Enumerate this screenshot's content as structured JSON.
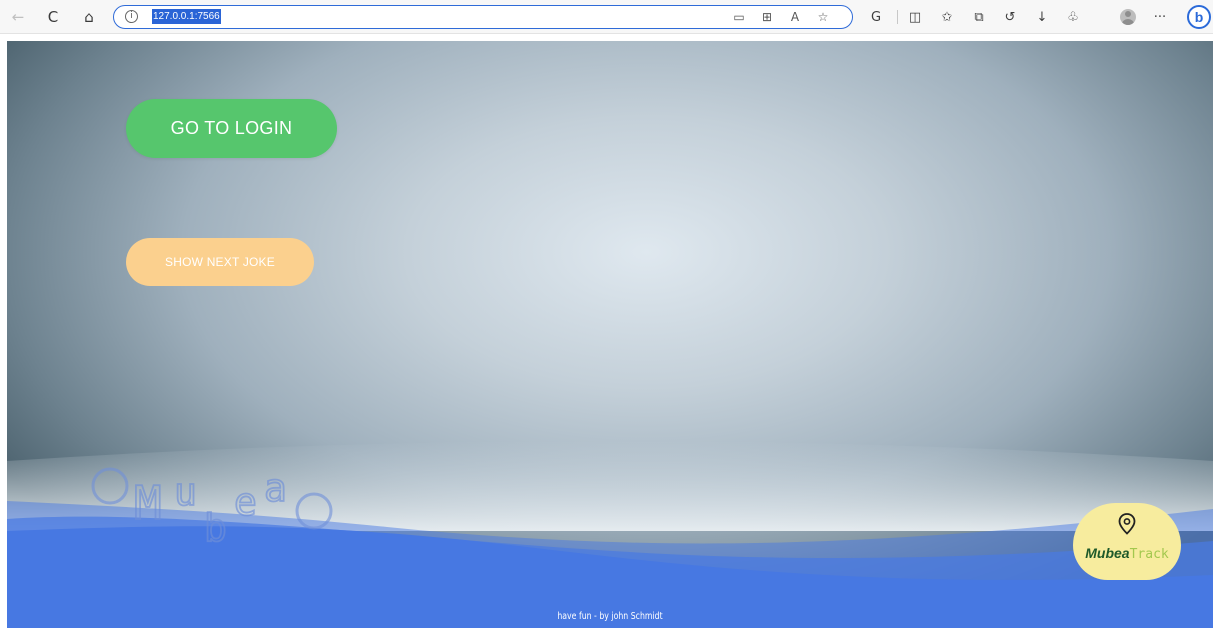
{
  "browser": {
    "url": "127.0.0.1:7566",
    "icons": {
      "back": "←",
      "refresh": "C",
      "home": "⌂",
      "info": "i",
      "reader": "▭",
      "apps": "⊞",
      "read_aloud": "A",
      "favorite": "☆",
      "copilot": "G",
      "split": "◫",
      "favorites": "✩",
      "collections": "⧉",
      "history": "↺",
      "downloads": "↓",
      "extensions": "♧",
      "more": "···",
      "bing": "b"
    }
  },
  "page": {
    "login_button": "GO TO LOGIN",
    "joke_button": "SHOW NEXT JOKE",
    "logo_letters": [
      "M",
      "u",
      "b",
      "e",
      "a"
    ],
    "badge_part1": "Mubea",
    "badge_part2": "Track",
    "footer": "have fun - by john Schmidt"
  },
  "colors": {
    "login_green": "#56c66d",
    "joke_orange": "#fbd08e",
    "wave_blue": "#4a7ae2",
    "badge_yellow": "#f7ec9e"
  }
}
